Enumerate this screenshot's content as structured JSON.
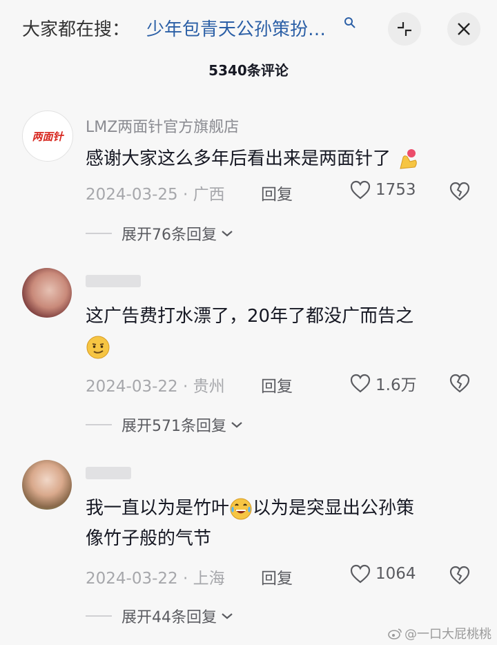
{
  "header": {
    "search_prefix": "大家都在搜：",
    "search_query": "少年包青天公孙策扮…",
    "comment_count": "5340条评论"
  },
  "comments": [
    {
      "username": "LMZ两面针官方旗舰店",
      "avatar_logo_text": "两面针",
      "text": "感谢大家这么多年后看出来是两面针了",
      "emoji": "heart-hands-emoji",
      "date": "2024-03-25",
      "location": "广西",
      "reply_label": "回复",
      "likes": "1753",
      "expand_label": "展开76条回复"
    },
    {
      "username": "",
      "text_line1": "这广告费打水漂了，20年了都没广而告之",
      "emoji": "smirk-emoji",
      "date": "2024-03-22",
      "location": "贵州",
      "reply_label": "回复",
      "likes": "1.6万",
      "expand_label": "展开571条回复"
    },
    {
      "username": "",
      "text_part1": "我一直以为是竹叶",
      "text_part2": "以为是突显出公孙策",
      "text_line2": "像竹子般的气节",
      "emoji": "laugh-tears-emoji",
      "date": "2024-03-22",
      "location": "上海",
      "reply_label": "回复",
      "likes": "1064",
      "expand_label": "展开44条回复"
    }
  ],
  "separator": "·",
  "watermark": "@一口大屁桃桃",
  "colors": {
    "link": "#2b5fa6",
    "brand_red": "#d7261e",
    "meta": "#a6a7ab"
  }
}
